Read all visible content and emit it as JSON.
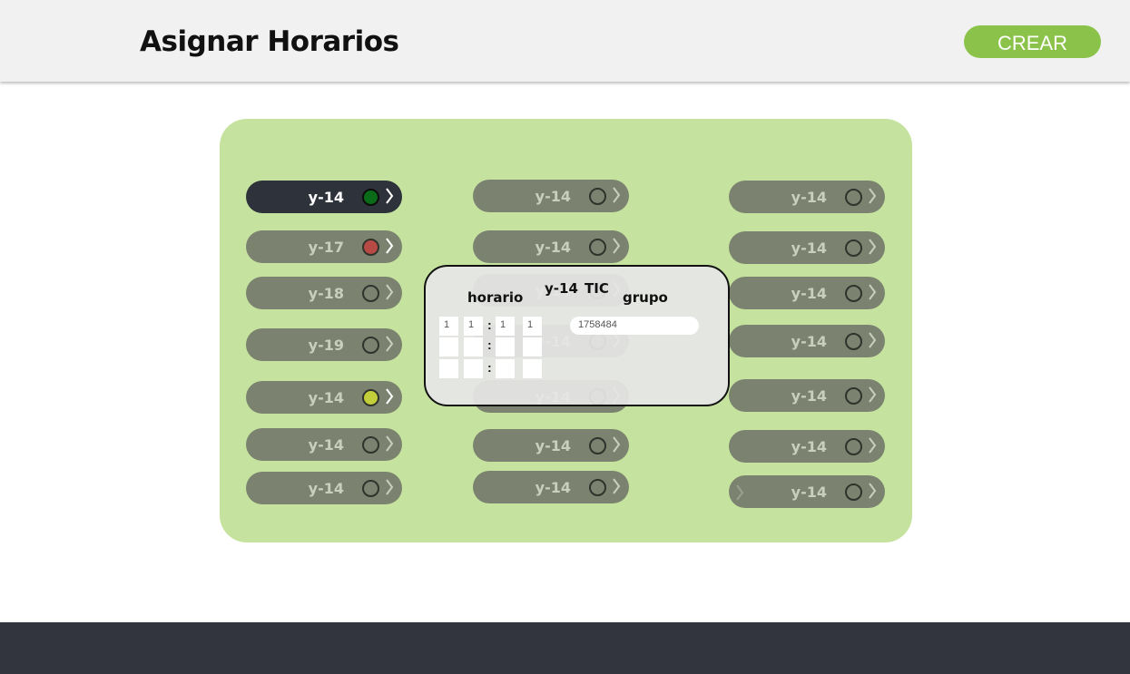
{
  "header": {
    "title": "Asignar Horarios",
    "create_label": "CREAR"
  },
  "columns": [
    [
      {
        "label": "y-14",
        "status": "green",
        "active": true
      },
      {
        "label": "y-17",
        "status": "red",
        "active": false
      },
      {
        "label": "y-18",
        "status": "none",
        "active": false
      },
      {
        "label": "y-19",
        "status": "none",
        "active": false
      },
      {
        "label": "y-14",
        "status": "yellow",
        "active": false
      },
      {
        "label": "y-14",
        "status": "none",
        "active": false
      },
      {
        "label": "y-14",
        "status": "none",
        "active": false
      }
    ],
    [
      {
        "label": "y-14",
        "status": "none",
        "active": false
      },
      {
        "label": "y-14",
        "status": "none",
        "active": false
      },
      {
        "label": "y-14",
        "status": "none",
        "active": false
      },
      {
        "label": "y-14",
        "status": "none",
        "active": false
      },
      {
        "label": "y-14",
        "status": "none",
        "active": false
      },
      {
        "label": "y-14",
        "status": "none",
        "active": false
      },
      {
        "label": "y-14",
        "status": "none",
        "active": false
      }
    ],
    [
      {
        "label": "y-14",
        "status": "none",
        "active": false
      },
      {
        "label": "y-14",
        "status": "none",
        "active": false
      },
      {
        "label": "y-14",
        "status": "none",
        "active": false
      },
      {
        "label": "y-14",
        "status": "none",
        "active": false
      },
      {
        "label": "y-14",
        "status": "none",
        "active": false
      },
      {
        "label": "y-14",
        "status": "none",
        "active": false
      },
      {
        "label": "y-14",
        "status": "none",
        "active": false
      }
    ]
  ],
  "status_colors": {
    "green": "#0a6b18",
    "red": "#b84a45",
    "yellow": "#c3cf3a"
  },
  "popup": {
    "horario_label": "horario",
    "group_code": "y-14",
    "tic_label": "TIC",
    "grupo_label": "grupo",
    "time_rows": [
      [
        "1",
        "1",
        "1",
        "1"
      ],
      [
        "",
        "",
        "",
        ""
      ],
      [
        "",
        "",
        "",
        ""
      ]
    ],
    "grupo_value": "1758484"
  }
}
